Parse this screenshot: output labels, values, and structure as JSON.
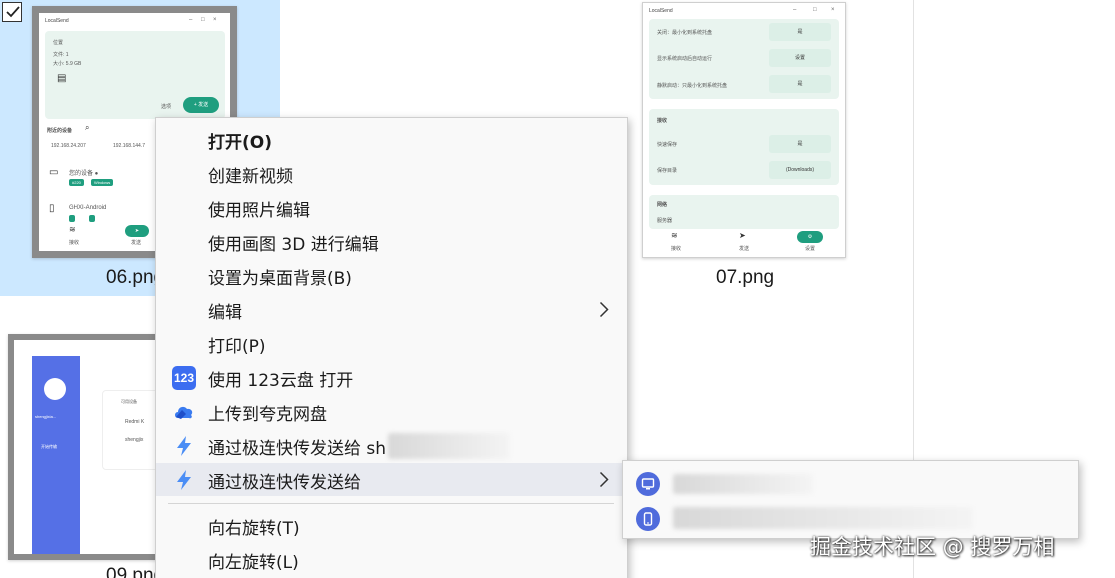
{
  "files": [
    {
      "label": "06.png",
      "selected": true
    },
    {
      "label": "07.png",
      "selected": false
    },
    {
      "label": "09.png",
      "selected": false
    }
  ],
  "thumb06": {
    "title": "LocalSend",
    "card_lines": [
      "位置",
      "文件: 1",
      "大小: 5.9 GB"
    ],
    "options_label": "选项",
    "send_label": "+ 发送",
    "nearby_label": "附近的设备",
    "ip1": "192.168.24.207",
    "ip2": "192.168.144.7",
    "device1_name": "您的设备 ●",
    "device1_chip1": "#220",
    "device1_chip2": "Windows",
    "device2_name": "GHXI-Android",
    "nav_receive": "接收",
    "nav_send": "发送"
  },
  "thumb07": {
    "title": "LocalSend",
    "row1_label": "关闭：最小化到系统托盘",
    "row1_value": "是",
    "row2_label": "显示系统启动后自动运行",
    "row2_value": "设置",
    "row3_label": "静默启动：只最小化到系统托盘",
    "row3_value": "是",
    "section_receive": "接收",
    "row4_label": "快速保存",
    "row4_value": "是",
    "row5_label": "保存目录",
    "row5_value": "(Downloads)",
    "section_network": "网络",
    "row6_label": "服务器",
    "nav_receive": "接收",
    "nav_send": "发送",
    "nav_settings": "设置"
  },
  "thumb09": {
    "sidebar_label": "shengjixia...",
    "sidebar_sub": "开始传输",
    "list_header": "可用设备",
    "device1": "Redmi K",
    "device2": "shengjix"
  },
  "context_menu": {
    "items": [
      {
        "label": "打开(O)",
        "bold": true
      },
      {
        "label": "创建新视频"
      },
      {
        "label": "使用照片编辑"
      },
      {
        "label": "使用画图 3D 进行编辑"
      },
      {
        "label": "设置为桌面背景(B)"
      },
      {
        "label": "编辑",
        "submenu": true
      },
      {
        "label": "打印(P)"
      },
      {
        "label": "使用 123云盘 打开",
        "icon": "123pan-icon",
        "icon_text": "123"
      },
      {
        "label": "上传到夸克网盘",
        "icon": "quark-cloud-icon"
      },
      {
        "label": "通过极连快传发送给 sh",
        "icon": "lightning-icon"
      },
      {
        "label": "通过极连快传发送给",
        "icon": "lightning-icon",
        "submenu": true,
        "hover": true
      },
      {
        "label": "向右旋转(T)"
      },
      {
        "label": "向左旋转(L)"
      }
    ]
  },
  "submenu_items": [
    {
      "icon": "device-windows-icon"
    },
    {
      "icon": "device-phone-icon"
    }
  ],
  "colors": {
    "selection": "#cce8ff",
    "accent_green": "#1f9e7f",
    "accent_blue": "#4f6bdc"
  },
  "watermark": "掘金技术社区 @ 搜罗万相"
}
